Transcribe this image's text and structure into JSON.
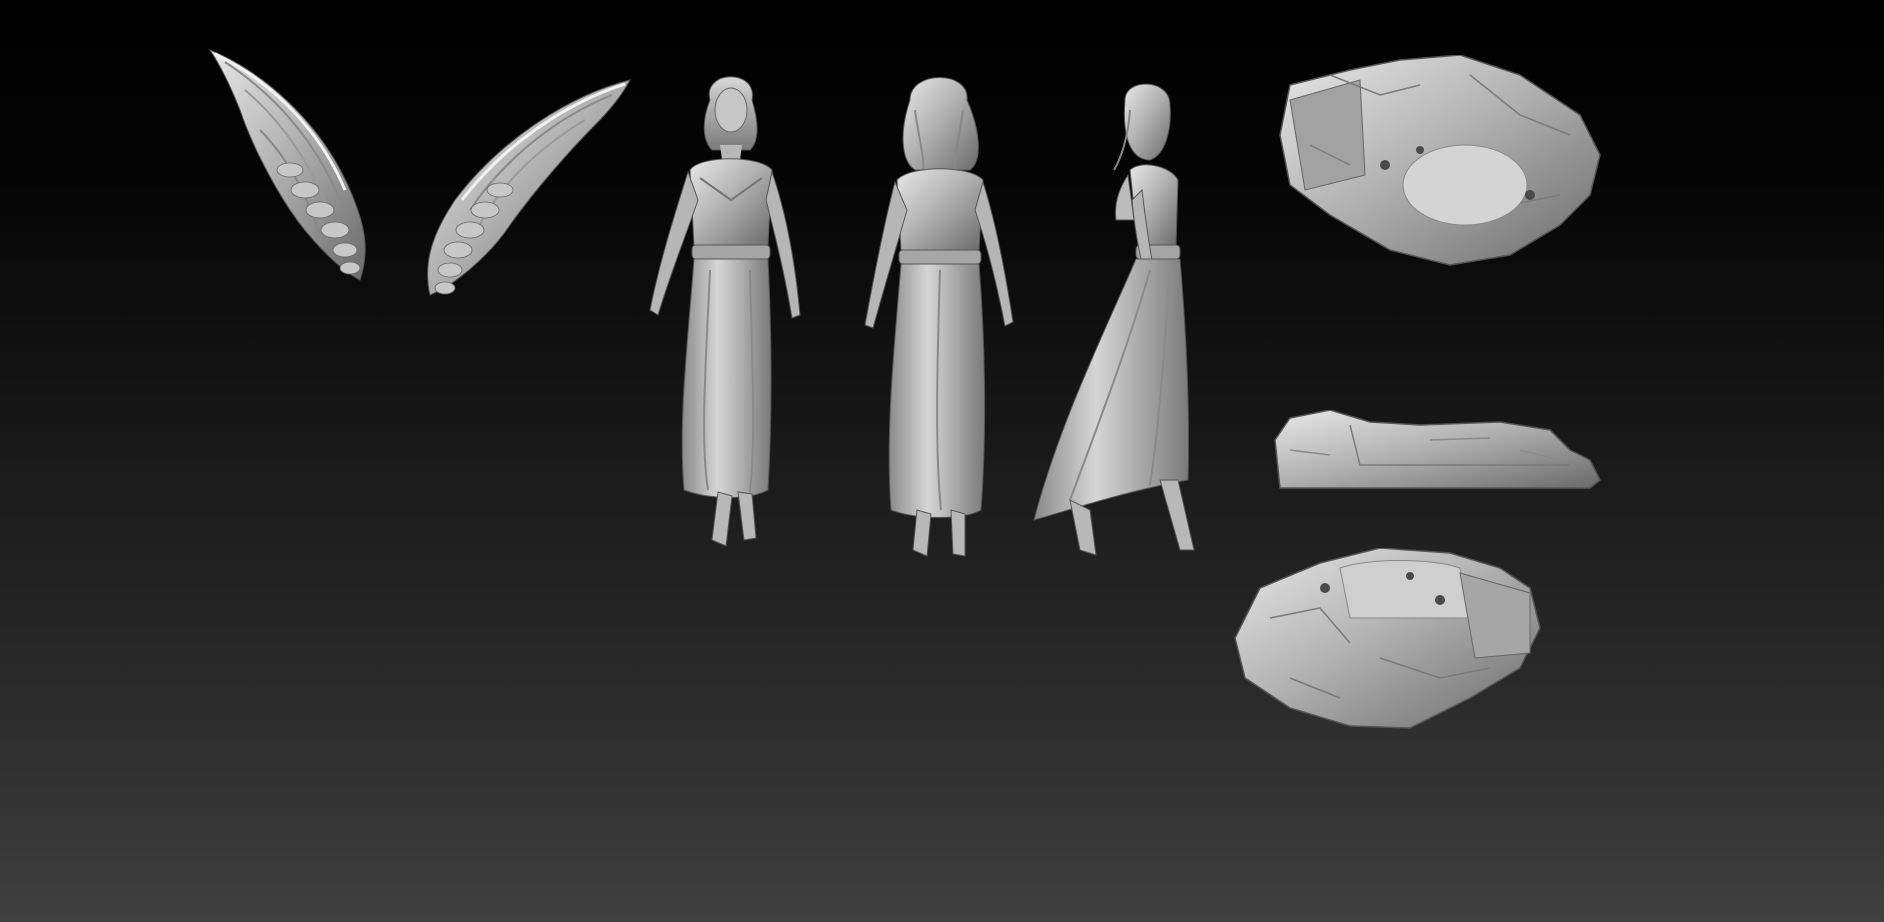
{
  "scene": {
    "background": {
      "top": "#000000",
      "bottom": "#3f3f3f"
    },
    "material_colors": {
      "highlight": "#e6e6e6",
      "mid": "#b0b0b0",
      "shadow": "#5c5c5c"
    },
    "models": [
      {
        "name": "wings",
        "view": "front"
      },
      {
        "name": "figure",
        "view": "front"
      },
      {
        "name": "figure",
        "view": "back"
      },
      {
        "name": "figure",
        "view": "side"
      },
      {
        "name": "rock-base",
        "view": "top"
      },
      {
        "name": "rock-base",
        "view": "side"
      },
      {
        "name": "rock-base",
        "view": "bottom"
      }
    ]
  }
}
